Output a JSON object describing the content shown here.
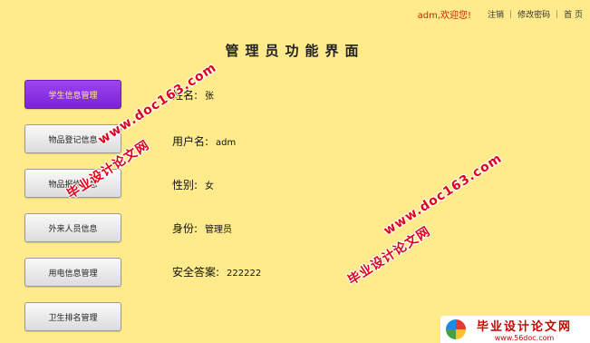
{
  "header": {
    "welcome": "adm,欢迎您!",
    "logout_label": "注销",
    "change_password_label": "修改密码",
    "home_label": "首 页",
    "separator": "|"
  },
  "page_title": "管理员功能界面",
  "menu": {
    "items": [
      {
        "label": "学生信息管理"
      },
      {
        "label": "物品登记信息"
      },
      {
        "label": "物品报修信息"
      },
      {
        "label": "外来人员信息"
      },
      {
        "label": "用电信息管理"
      },
      {
        "label": "卫生排名管理"
      }
    ]
  },
  "profile": {
    "name_label": "姓名:",
    "name_value": "张",
    "username_label": "用户名:",
    "username_value": "adm",
    "gender_label": "性别:",
    "gender_value": "女",
    "role_label": "身份:",
    "role_value": "管理员",
    "security_answer_label": "安全答案:",
    "security_answer_value": "222222"
  },
  "watermarks": {
    "site_cn": "毕业设计论文网",
    "site_url": "www.doc163.com"
  },
  "logo": {
    "title": "毕业设计论文网",
    "url": "www.56doc.com"
  },
  "colors": {
    "background": "#FFEB8C",
    "active_menu": "#8A2BE2",
    "welcome_text": "#CC2200",
    "watermark": "#E0001A"
  }
}
